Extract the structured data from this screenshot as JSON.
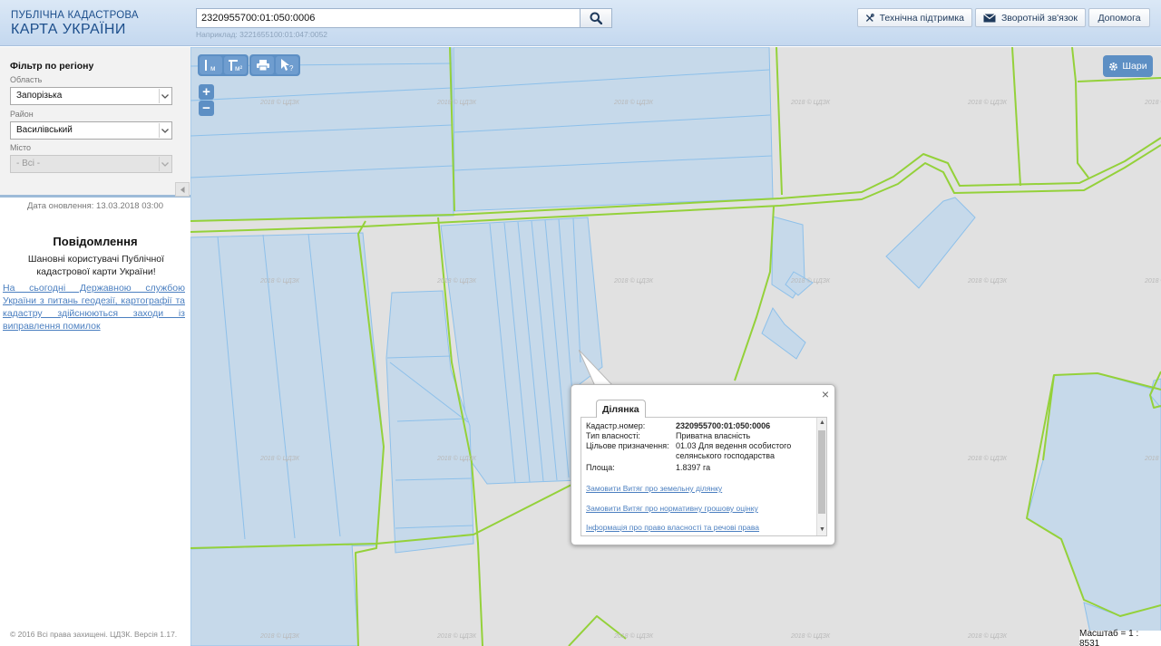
{
  "header": {
    "logo_line1": "ПУБЛІЧНА КАДАСТРОВА",
    "logo_line2": "КАРТА УКРАЇНИ",
    "search_value": "2320955700:01:050:0006",
    "search_example": "Наприклад: 3221655100:01:047:0052",
    "support_label": "Технічна підтримка",
    "feedback_label": "Зворотній зв'язок",
    "help_label": "Допомога"
  },
  "sidebar": {
    "filter_title": "Фільтр по регіону",
    "oblast_label": "Область",
    "oblast_value": "Запорізька",
    "rayon_label": "Район",
    "rayon_value": "Василівський",
    "city_label": "Місто",
    "city_value": "- Всі -",
    "update_date": "Дата оновлення: 13.03.2018 03:00",
    "notice_title": "Повідомлення",
    "notice_text": "Шановні користувачі Публічної кадастрової карти України!",
    "notice_link": "На сьогодні Державною службою України з питань геодезії, картографії та кадастру здійснюються заходи із виправлення помилок",
    "copyright": "© 2016 Всі права захищені. ЦДЗК. Версія 1.17."
  },
  "map": {
    "tools": {
      "length": "м",
      "area": "м²",
      "identify": "?"
    },
    "zoom_in": "+",
    "zoom_out": "−",
    "layers_label": "Шари",
    "scale_text": "Масштаб = 1 : 8531",
    "watermark": "2018 © ЦДЗК"
  },
  "popup": {
    "close": "×",
    "tab_label": "Ділянка",
    "rows": [
      {
        "key": "Кадастр.номер:",
        "value": "2320955700:01:050:0006"
      },
      {
        "key": "Тип власності:",
        "value": "Приватна власність"
      },
      {
        "key": "Цільове призначення:",
        "value": "01.03 Для ведення особистого селянського господарства"
      },
      {
        "key": "Площа:",
        "value": "1.8397 га"
      }
    ],
    "links": [
      "Замовити Витяг про земельну ділянку",
      "Замовити Витяг про нормативну грошову оцінку",
      "Інформація про право власності та речові права"
    ]
  },
  "colors": {
    "parcel_fill": "#c6d9ea",
    "parcel_stroke": "#8dc0ea",
    "road": "#94d13a",
    "accent": "#5d8fc4",
    "link": "#4b7fc0"
  }
}
